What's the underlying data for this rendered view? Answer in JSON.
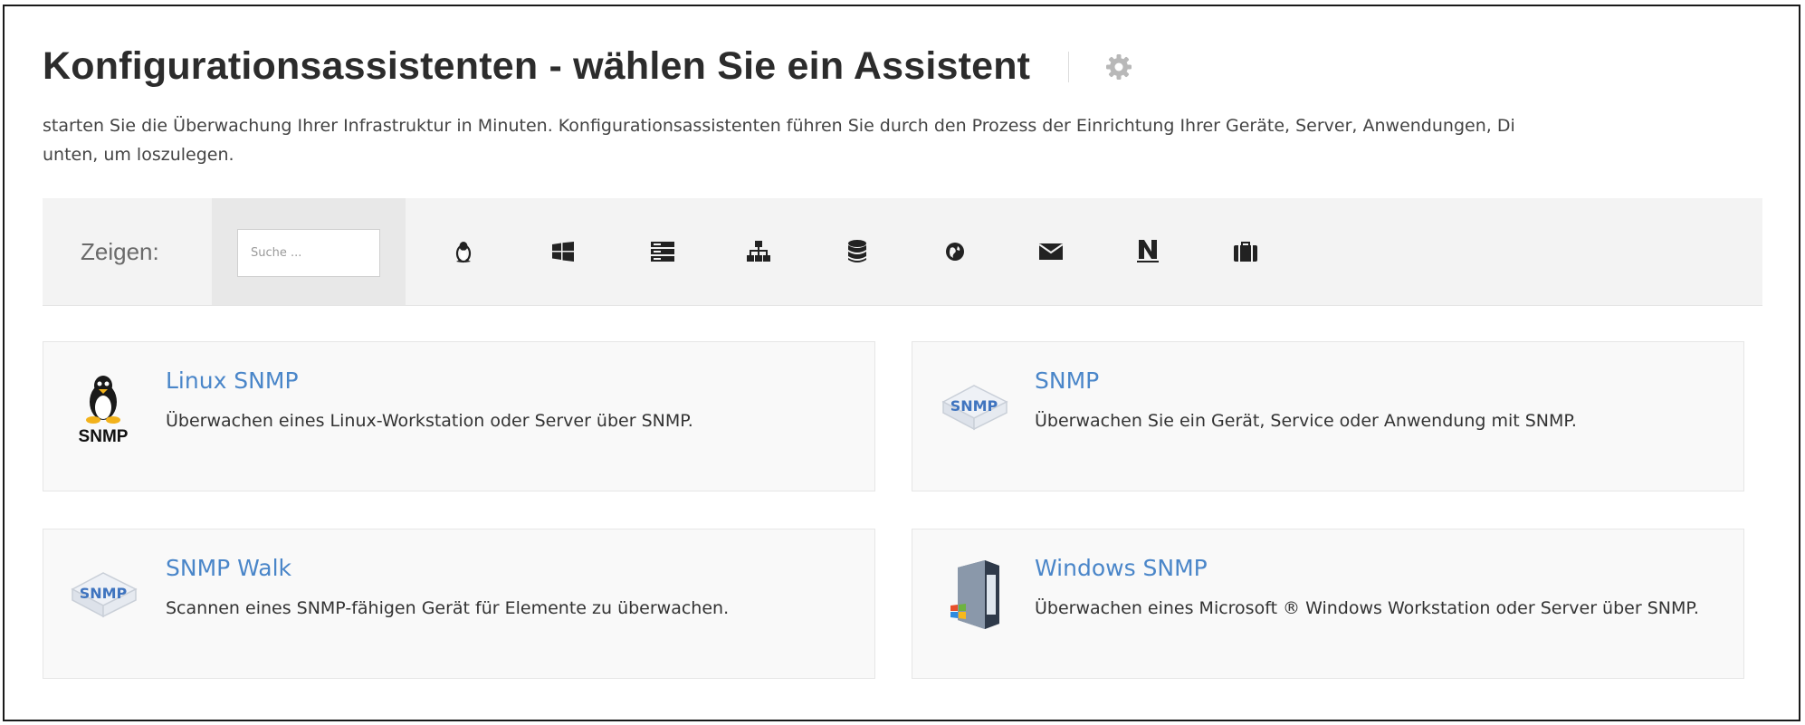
{
  "page": {
    "title": "Konfigurationsassistenten - wählen Sie ein Assistent",
    "settings_icon": "gear-icon",
    "intro_line1": "starten Sie die Überwachung Ihrer Infrastruktur in Minuten. Konfigurationsassistenten führen Sie durch den Prozess der Einrichtung Ihrer Geräte, Server, Anwendungen, Di",
    "intro_line2": "unten, um loszulegen."
  },
  "filter": {
    "show_label": "Zeigen:",
    "search_placeholder": "Suche ...",
    "search_value": "",
    "icons": [
      "linux-icon",
      "windows-icon",
      "server-icon",
      "network-icon",
      "database-icon",
      "globe-icon",
      "mail-icon",
      "nagios-icon",
      "briefcase-icon"
    ]
  },
  "wizards": [
    {
      "title": "Linux SNMP",
      "description": "Überwachen eines Linux-Workstation oder Server über SNMP.",
      "icon": "linux-snmp-icon",
      "icon_label": "SNMP"
    },
    {
      "title": "SNMP",
      "description": "Überwachen Sie ein Gerät, Service oder Anwendung mit SNMP.",
      "icon": "snmp-icon",
      "icon_label": "SNMP"
    },
    {
      "title": "SNMP Walk",
      "description": "Scannen eines SNMP-fähigen Gerät für Elemente zu überwachen.",
      "icon": "snmp-walk-icon",
      "icon_label": "SNMP"
    },
    {
      "title": "Windows SNMP",
      "description": "Überwachen eines Microsoft ® Windows Workstation oder Server über SNMP.",
      "icon": "windows-server-icon"
    }
  ],
  "colors": {
    "link": "#4a86c9",
    "title": "#2c2c2c",
    "card_bg": "#f9f9f9",
    "bar_bg": "#f3f3f3"
  }
}
